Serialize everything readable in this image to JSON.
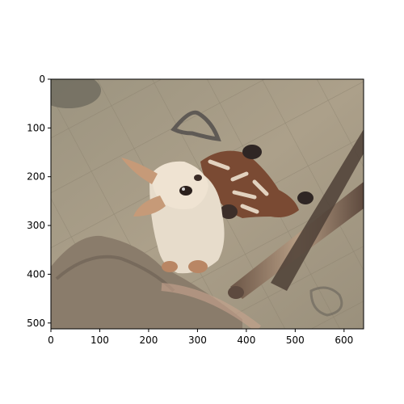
{
  "chart_data": {
    "type": "image",
    "image_subject": "stylized photo of a small dog with a giraffe plush toy on a tiled floor",
    "image_width": 640,
    "image_height": 512,
    "x": {
      "range": [
        0,
        640
      ],
      "ticks": [
        0,
        100,
        200,
        300,
        400,
        500,
        600
      ],
      "tick_labels": [
        "0",
        "100",
        "200",
        "300",
        "400",
        "500",
        "600"
      ]
    },
    "y": {
      "range": [
        0,
        512
      ],
      "inverted": true,
      "ticks": [
        0,
        100,
        200,
        300,
        400,
        500
      ],
      "tick_labels": [
        "0",
        "100",
        "200",
        "300",
        "400",
        "500"
      ]
    },
    "grid": false
  }
}
